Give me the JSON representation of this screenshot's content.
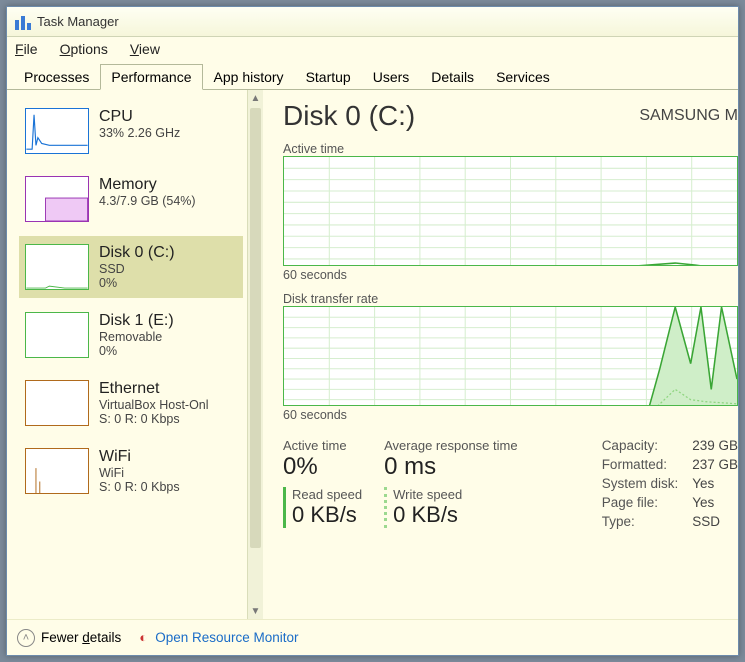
{
  "window": {
    "title": "Task Manager"
  },
  "menu": {
    "file": "File",
    "options": "Options",
    "view": "View"
  },
  "tabs": [
    {
      "id": "processes",
      "label": "Processes"
    },
    {
      "id": "performance",
      "label": "Performance"
    },
    {
      "id": "apphistory",
      "label": "App history"
    },
    {
      "id": "startup",
      "label": "Startup"
    },
    {
      "id": "users",
      "label": "Users"
    },
    {
      "id": "details",
      "label": "Details"
    },
    {
      "id": "services",
      "label": "Services"
    }
  ],
  "tabs_active": "performance",
  "sidebar": [
    {
      "id": "cpu",
      "title": "CPU",
      "line1": "33%  2.26 GHz",
      "border": "#1a73d6"
    },
    {
      "id": "memory",
      "title": "Memory",
      "line1": "4.3/7.9 GB (54%)",
      "border": "#9a34b3"
    },
    {
      "id": "disk0",
      "title": "Disk 0 (C:)",
      "line1": "SSD",
      "line2": "0%",
      "border": "#4bb749",
      "selected": true
    },
    {
      "id": "disk1",
      "title": "Disk 1 (E:)",
      "line1": "Removable",
      "line2": "0%",
      "border": "#4bb749"
    },
    {
      "id": "ethernet",
      "title": "Ethernet",
      "line1": "VirtualBox Host-Onl",
      "line2": "S: 0 R: 0 Kbps",
      "border": "#b06a1c"
    },
    {
      "id": "wifi",
      "title": "WiFi",
      "line1": "WiFi",
      "line2": "S: 0 R: 0 Kbps",
      "border": "#b06a1c"
    }
  ],
  "main": {
    "title": "Disk 0 (C:)",
    "subtitle": "SAMSUNG M",
    "chart1_label": "Active time",
    "chart1_axis": "60 seconds",
    "chart2_label": "Disk transfer rate",
    "chart2_axis": "60 seconds",
    "active_time_label": "Active time",
    "active_time_value": "0%",
    "avg_response_label": "Average response time",
    "avg_response_value": "0 ms",
    "read_label": "Read speed",
    "read_value": "0 KB/s",
    "write_label": "Write speed",
    "write_value": "0 KB/s",
    "props": {
      "capacity_k": "Capacity:",
      "capacity_v": "239 GB",
      "formatted_k": "Formatted:",
      "formatted_v": "237 GB",
      "sysdisk_k": "System disk:",
      "sysdisk_v": "Yes",
      "pagefile_k": "Page file:",
      "pagefile_v": "Yes",
      "type_k": "Type:",
      "type_v": "SSD"
    }
  },
  "footer": {
    "fewer": "Fewer details",
    "resmon": "Open Resource Monitor"
  },
  "chart_data": [
    {
      "type": "line",
      "title": "Active time",
      "xlabel": "60 seconds",
      "ylabel": "",
      "ylim": [
        0,
        100
      ],
      "x": [
        60,
        55,
        50,
        45,
        40,
        35,
        30,
        25,
        20,
        15,
        10,
        5,
        0
      ],
      "values": [
        0,
        0,
        0,
        0,
        0,
        0,
        0,
        0,
        2,
        5,
        3,
        1,
        0
      ]
    },
    {
      "type": "line",
      "title": "Disk transfer rate",
      "xlabel": "60 seconds",
      "ylabel": "",
      "ylim": [
        0,
        100
      ],
      "series": [
        {
          "name": "Read",
          "values": [
            0,
            0,
            0,
            0,
            0,
            0,
            0,
            0,
            5,
            35,
            95,
            60,
            90
          ]
        },
        {
          "name": "Write",
          "values": [
            0,
            0,
            0,
            0,
            0,
            0,
            0,
            0,
            2,
            20,
            10,
            8,
            6
          ]
        }
      ],
      "x": [
        60,
        55,
        50,
        45,
        40,
        35,
        30,
        25,
        20,
        15,
        10,
        5,
        0
      ]
    }
  ]
}
